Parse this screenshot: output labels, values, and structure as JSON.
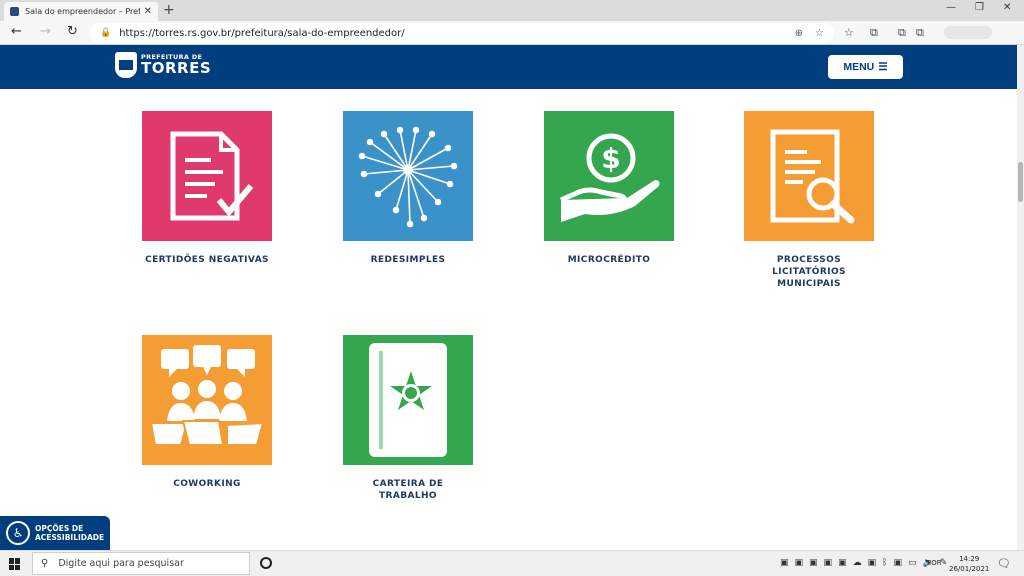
{
  "browser": {
    "tab_title": "Sala do empreendedor – Prefeitura",
    "url": "https://torres.rs.gov.br/prefeitura/sala-do-empreendedor/"
  },
  "site": {
    "logo_small": "PREFEITURA DE",
    "logo_big": "TORRES",
    "menu_label": "MENU"
  },
  "tiles": [
    {
      "label": "CERTIDÕES NEGATIVAS",
      "color": "#e0396b",
      "icon": "certificate-document-icon"
    },
    {
      "label": "REDESIMPLES",
      "color": "#3a92c8",
      "icon": "network-map-icon"
    },
    {
      "label": "MICROCRÉDITO",
      "color": "#34a64d",
      "icon": "money-hand-icon"
    },
    {
      "label": "PROCESSOS\nLICITATÓRIOS\nMUNICIPAIS",
      "color": "#f39d34",
      "icon": "document-search-icon"
    },
    {
      "label": "COWORKING",
      "color": "#f39d34",
      "icon": "coworking-people-icon"
    },
    {
      "label": "CARTEIRA DE TRABALHO",
      "color": "#34a64d",
      "icon": "work-card-icon"
    }
  ],
  "accessibility": {
    "line1": "OPÇÕES DE",
    "line2": "ACESSIBILIDADE"
  },
  "taskbar": {
    "search_placeholder": "Digite aqui para pesquisar",
    "language": "POR",
    "time": "14:29",
    "date": "26/01/2021"
  }
}
